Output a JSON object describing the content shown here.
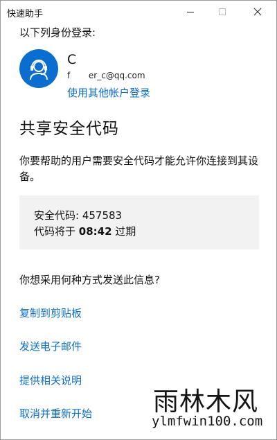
{
  "window": {
    "title": "快速助手"
  },
  "signin": {
    "title": "以下列身份登录:",
    "user_name": "C",
    "user_email": "f       er_c@qq.com",
    "other_account_link": "使用其他帐户登录"
  },
  "share_code": {
    "heading": "共享安全代码",
    "description": "你要帮助的用户需要安全代码才能允许你连接到其设备。",
    "code_label": "安全代码: ",
    "code_value": "457583",
    "expiry_prefix": "代码将于 ",
    "expiry_time": "08:42",
    "expiry_suffix": " 过期"
  },
  "send": {
    "question": "你想采用何种方式发送此信息?",
    "options": [
      "复制到剪贴板",
      "发送电子邮件",
      "提供相关说明",
      "取消并重新开始"
    ]
  },
  "watermark": {
    "brand": "雨林木风",
    "url": "ylmfwin100.com"
  },
  "colors": {
    "link": "#0a6ed1",
    "avatar_bg": "#0a6ed1",
    "code_box_bg": "#f2f2f2"
  },
  "icons": {
    "avatar": "headset-support-icon",
    "minimize": "minimize-icon",
    "maximize": "maximize-icon",
    "close": "close-icon"
  }
}
